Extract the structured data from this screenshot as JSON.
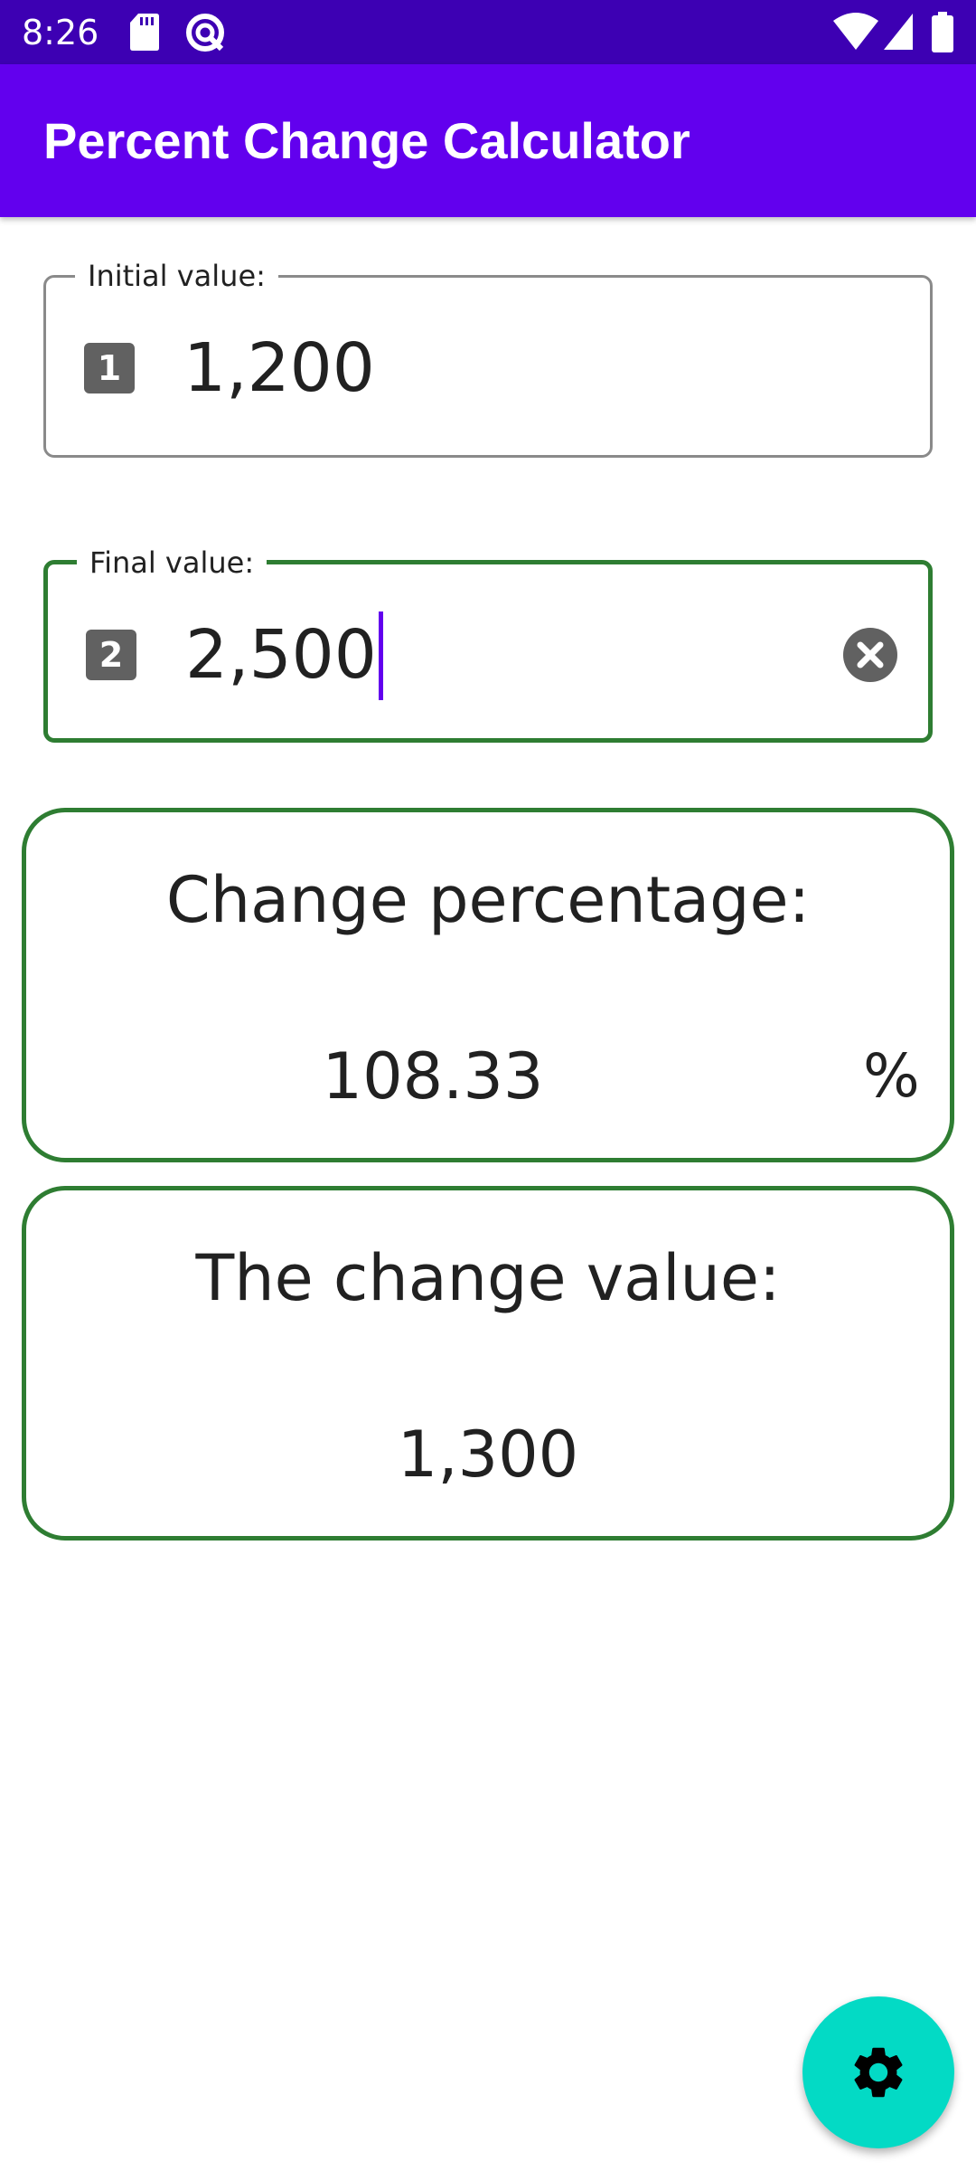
{
  "status_bar": {
    "time": "8:26",
    "left_icons": [
      "sd-card-icon",
      "data-saver-icon"
    ],
    "right_icons": [
      "wifi-icon",
      "cellular-signal-icon",
      "battery-icon"
    ]
  },
  "app_bar": {
    "title": "Percent Change Calculator",
    "background_color": "#6200ee"
  },
  "fields": {
    "initial": {
      "label": "Initial value:",
      "badge": "1",
      "value": "1,200"
    },
    "final": {
      "label": "Final value:",
      "badge": "2",
      "value": "2,500",
      "focused": true
    }
  },
  "results": {
    "percentage": {
      "title": "Change percentage:",
      "value": "108.33",
      "unit": "%"
    },
    "change": {
      "title": "The change value:",
      "value": "1,300"
    }
  },
  "fab": {
    "icon": "gear-icon",
    "color": "#03dac5"
  },
  "colors": {
    "accent": "#6200ee",
    "status_bar": "#3d00b3",
    "card_border": "#2e7d32"
  }
}
